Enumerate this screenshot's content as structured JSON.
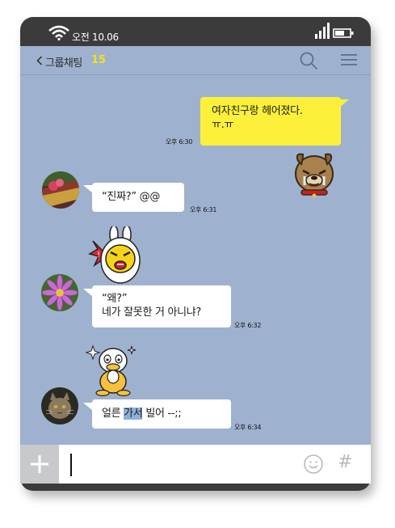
{
  "status": {
    "time": "오전 10.06"
  },
  "header": {
    "title": "그룹채팅",
    "count": "15"
  },
  "messages": {
    "m1": {
      "line1": "여자친구랑 헤어졌다.",
      "line2": "ㅠ.ㅠ",
      "time": "오후 6:30"
    },
    "m2": {
      "text": "“진짜?” @@",
      "time": "오후 6:31"
    },
    "m3": {
      "line1": "“왜?”",
      "line2": "네가 잘못한 거 아니냐?",
      "time": "오후 6:32"
    },
    "m4": {
      "before": "얼른 ",
      "highlight": "가서",
      "after": " 빌어 --;;",
      "time": "오후 6:34"
    }
  },
  "colors": {
    "chat_bg": "#9eb2cf",
    "my_bubble": "#fdf03a",
    "frame": "#3c3b3b",
    "count_accent": "#f5e11f"
  }
}
